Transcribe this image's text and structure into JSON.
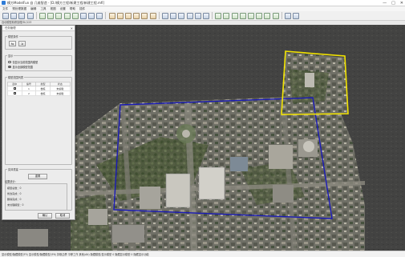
{
  "window": {
    "title": "模方ModelFun 自 几维智造 - [D:/模方工程/新建工程/新建工程.mfi]",
    "controls": [
      "—",
      "□",
      "✕"
    ]
  },
  "menu": [
    "文件",
    "预处理数据",
    "编辑",
    "工具",
    "视图",
    "设置",
    "帮助",
    "插件"
  ],
  "path_line": "自动模型精修处理/D:/123",
  "panel": {
    "title": "任务管理",
    "close": "✕",
    "ops_group": "模型操作",
    "btn_a": "⇆",
    "btn_b": "⇲",
    "display_group": "显示",
    "radio_1": "仅显示当前范围内模型",
    "radio_2": "显示全部模型范围",
    "list_group": "模型范围列表",
    "columns": [
      "选中",
      "编号",
      "类型",
      "状态"
    ],
    "rows": [
      {
        "id": "1",
        "type": "楼栋",
        "status": "未编辑"
      },
      {
        "id": "2",
        "type": "楼栋",
        "status": "未编辑"
      }
    ],
    "recon_group": "实体重建",
    "reset_button": "重置",
    "info_title": "结果统计：",
    "info_lines": [
      "模型总数：0",
      "修改完成：0",
      "删除完成：0",
      "未处理模型：0"
    ],
    "ok_button": "确认",
    "cancel_button": "取消"
  },
  "status_bar": "显示模型/隐藏模型(F5)   显示模型/隐藏模型/(F6)   扣取边界   平移工作   其他(Alt)   隐藏模型/显示模型   0 隐藏显示模型   0 隐藏显示功能",
  "colors": {
    "selection_blue": "#1a1ab8",
    "selection_yellow": "#f2e300"
  }
}
